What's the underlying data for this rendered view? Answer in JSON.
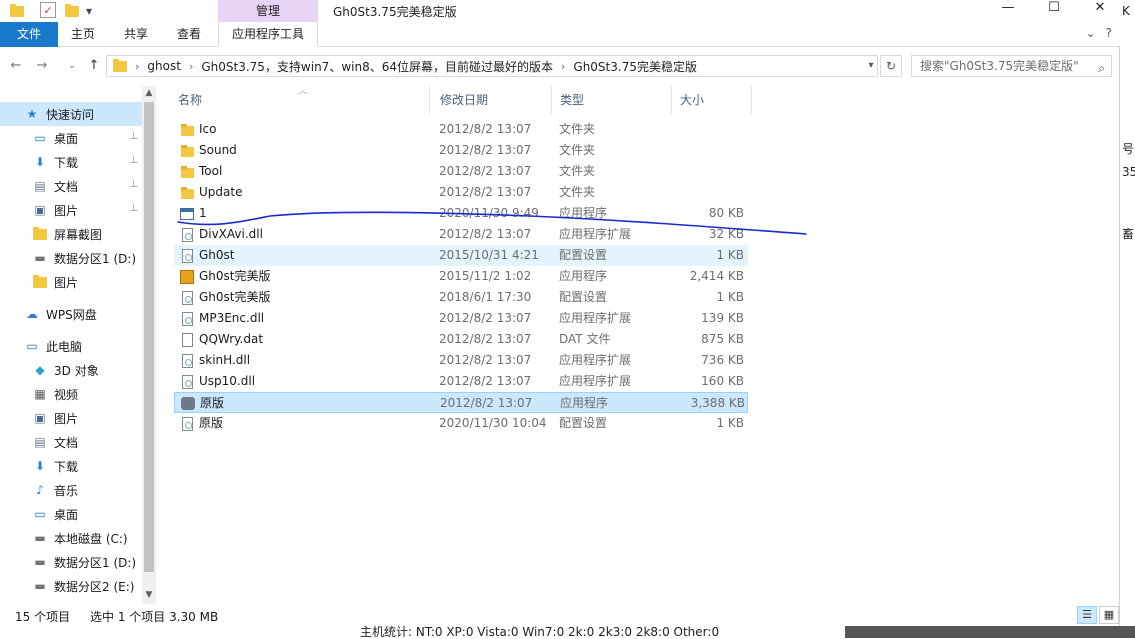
{
  "window": {
    "title": "Gh0St3.75完美稳定版",
    "manage_tab": "管理",
    "minimize": "—",
    "maximize": "☐",
    "close": "✕",
    "qa_dropdown": "▾"
  },
  "ribbon": {
    "tabs": [
      "文件",
      "主页",
      "共享",
      "查看",
      "应用程序工具"
    ],
    "expand": "⌄",
    "help": "?"
  },
  "address": {
    "back": "←",
    "forward": "→",
    "recent": "⌄",
    "up": "↑",
    "crumbs": [
      "ghost",
      "Gh0St3.75，支持win7、win8、64位屏幕，目前碰过最好的版本",
      "Gh0St3.75完美稳定版"
    ],
    "refresh": "↻",
    "search_placeholder": "搜索\"Gh0St3.75完美稳定版\""
  },
  "nav": {
    "items": [
      {
        "label": "快速访问",
        "icon": "star-icon",
        "glyph": "★",
        "color": "#2d7dd2"
      },
      {
        "label": "桌面",
        "icon": "desktop-icon",
        "glyph": "▭",
        "color": "#1f76d2",
        "pinned": true
      },
      {
        "label": "下载",
        "icon": "download-icon",
        "glyph": "⬇",
        "color": "#2d7dd2",
        "pinned": true
      },
      {
        "label": "文档",
        "icon": "document-icon",
        "glyph": "▤",
        "color": "#6a7a8a",
        "pinned": true
      },
      {
        "label": "图片",
        "icon": "pictures-icon",
        "glyph": "▣",
        "color": "#4a6a8a",
        "pinned": true
      },
      {
        "label": "屏幕截图",
        "icon": "folder-icon",
        "glyph": "",
        "color": "#f3c740"
      },
      {
        "label": "数据分区1 (D:)",
        "icon": "drive-icon",
        "glyph": "▬",
        "color": "#777777"
      },
      {
        "label": "图片",
        "icon": "folder-icon",
        "glyph": "",
        "color": "#f3c740"
      },
      {
        "label": "WPS网盘",
        "icon": "cloud-icon",
        "glyph": "☁",
        "color": "#3a7bd5"
      },
      {
        "label": "此电脑",
        "icon": "computer-icon",
        "glyph": "▭",
        "color": "#3a6ea5"
      },
      {
        "label": "3D 对象",
        "icon": "3d-objects-icon",
        "glyph": "◆",
        "color": "#2aa2d6"
      },
      {
        "label": "视频",
        "icon": "video-icon",
        "glyph": "▦",
        "color": "#555555"
      },
      {
        "label": "图片",
        "icon": "pictures-icon",
        "glyph": "▣",
        "color": "#4a6a8a"
      },
      {
        "label": "文档",
        "icon": "document-icon",
        "glyph": "▤",
        "color": "#6a7a8a"
      },
      {
        "label": "下载",
        "icon": "download-icon",
        "glyph": "⬇",
        "color": "#2d7dd2"
      },
      {
        "label": "音乐",
        "icon": "music-icon",
        "glyph": "♪",
        "color": "#2d7dd2"
      },
      {
        "label": "桌面",
        "icon": "desktop-icon",
        "glyph": "▭",
        "color": "#1f76d2"
      },
      {
        "label": "本地磁盘 (C:)",
        "icon": "drive-icon",
        "glyph": "▬",
        "color": "#777777"
      },
      {
        "label": "数据分区1 (D:)",
        "icon": "drive-icon",
        "glyph": "▬",
        "color": "#777777"
      },
      {
        "label": "数据分区2 (E:)",
        "icon": "drive-icon",
        "glyph": "▬",
        "color": "#777777"
      }
    ],
    "pin_glyph": "📌"
  },
  "columns": [
    "名称",
    "修改日期",
    "类型",
    "大小"
  ],
  "files": [
    {
      "name": "Ico",
      "date": "2012/8/2 13:07",
      "type": "文件夹",
      "size": "",
      "icon": "folder"
    },
    {
      "name": "Sound",
      "date": "2012/8/2 13:07",
      "type": "文件夹",
      "size": "",
      "icon": "folder"
    },
    {
      "name": "Tool",
      "date": "2012/8/2 13:07",
      "type": "文件夹",
      "size": "",
      "icon": "folder"
    },
    {
      "name": "Update",
      "date": "2012/8/2 13:07",
      "type": "文件夹",
      "size": "",
      "icon": "folder"
    },
    {
      "name": "1",
      "date": "2020/11/30 9:49",
      "type": "应用程序",
      "size": "80 KB",
      "icon": "app"
    },
    {
      "name": "DivXAvi.dll",
      "date": "2012/8/2 13:07",
      "type": "应用程序扩展",
      "size": "32 KB",
      "icon": "doc"
    },
    {
      "name": "Gh0st",
      "date": "2015/10/31 4:21",
      "type": "配置设置",
      "size": "1 KB",
      "icon": "doc"
    },
    {
      "name": "Gh0st完美版",
      "date": "2015/11/2 1:02",
      "type": "应用程序",
      "size": "2,414 KB",
      "icon": "gh"
    },
    {
      "name": "Gh0st完美版",
      "date": "2018/6/1 17:30",
      "type": "配置设置",
      "size": "1 KB",
      "icon": "doc"
    },
    {
      "name": "MP3Enc.dll",
      "date": "2012/8/2 13:07",
      "type": "应用程序扩展",
      "size": "139 KB",
      "icon": "doc"
    },
    {
      "name": "QQWry.dat",
      "date": "2012/8/2 13:07",
      "type": "DAT 文件",
      "size": "875 KB",
      "icon": "dat"
    },
    {
      "name": "skinH.dll",
      "date": "2012/8/2 13:07",
      "type": "应用程序扩展",
      "size": "736 KB",
      "icon": "doc"
    },
    {
      "name": "Usp10.dll",
      "date": "2012/8/2 13:07",
      "type": "应用程序扩展",
      "size": "160 KB",
      "icon": "doc"
    },
    {
      "name": "原版",
      "date": "2012/8/2 13:07",
      "type": "应用程序",
      "size": "3,388 KB",
      "icon": "orig"
    },
    {
      "name": "原版",
      "date": "2020/11/30 10:04",
      "type": "配置设置",
      "size": "1 KB",
      "icon": "doc"
    }
  ],
  "status": {
    "count": "15 个项目",
    "selected": "选中 1 个项目  3.30 MB"
  },
  "background": {
    "bottom_text": "主机统计:  NT:0  XP:0  Vista:0  Win7:0  2k:0  2k3:0  2k8:0  Other:0",
    "right_chars": [
      "K",
      "号",
      "35",
      "畜"
    ]
  }
}
